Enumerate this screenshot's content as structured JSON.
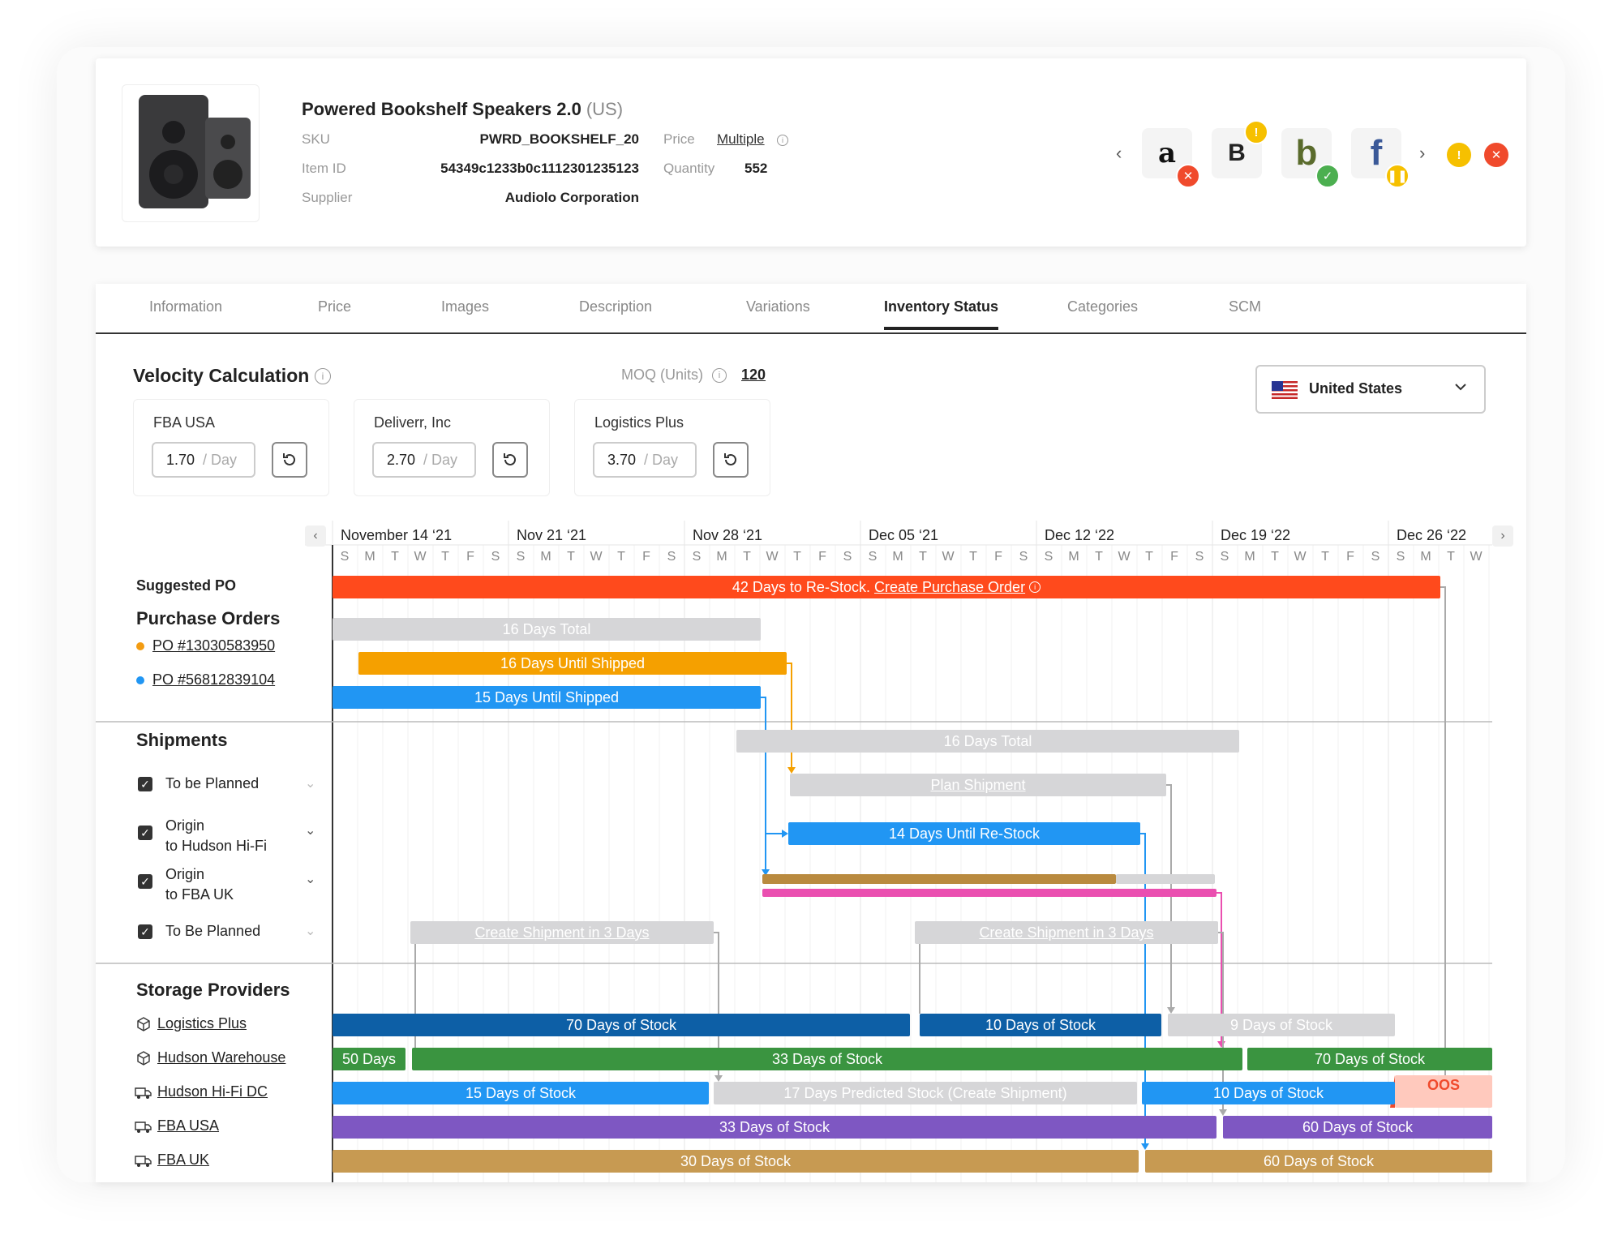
{
  "product": {
    "title": "Powered Bookshelf Speakers 2.0",
    "region": "(US)",
    "sku_label": "SKU",
    "sku": "PWRD_BOOKSHELF_20",
    "item_id_label": "Item ID",
    "item_id": "54349c1233b0c1112301235123",
    "supplier_label": "Supplier",
    "supplier": "Audiolo Corporation",
    "price_label": "Price",
    "price": "Multiple",
    "quantity_label": "Quantity",
    "quantity": "552"
  },
  "marketplaces": [
    {
      "icon": "amazon-icon",
      "glyph": "a",
      "status": "error",
      "status_color": "#f04a2c"
    },
    {
      "icon": "bigcommerce-icon",
      "glyph": "B",
      "status": "warning",
      "status_color": "#f6c000"
    },
    {
      "icon": "bonanza-icon",
      "glyph": "b",
      "status": "ok",
      "status_color": "#4caf50"
    },
    {
      "icon": "facebook-icon",
      "glyph": "f",
      "status": "paused",
      "status_color": "#f6c000"
    }
  ],
  "tabs": [
    "Information",
    "Price",
    "Images",
    "Description",
    "Variations",
    "Inventory Status",
    "Categories",
    "SCM"
  ],
  "active_tab": "Inventory Status",
  "velocity": {
    "title": "Velocity Calculation",
    "moq_label": "MOQ (Units)",
    "moq_value": "120",
    "providers": [
      {
        "name": "FBA USA",
        "value": "1.70",
        "unit": "/ Day"
      },
      {
        "name": "Deliverr, Inc",
        "value": "2.70",
        "unit": "/ Day"
      },
      {
        "name": "Logistics Plus",
        "value": "3.70",
        "unit": "/ Day"
      }
    ],
    "country": "United States"
  },
  "timeline": {
    "weeks": [
      "November 14 ‘21",
      "Nov 21 ‘21",
      "Nov 28 ‘21",
      "Dec 05 ‘21",
      "Dec 12 ‘22",
      "Dec 19 ‘22",
      "Dec 26 ‘22"
    ],
    "day_letters": [
      "S",
      "M",
      "T",
      "W",
      "T",
      "F",
      "S"
    ]
  },
  "groups": {
    "suggested_po": "Suggested PO",
    "purchase_orders": "Purchase Orders",
    "shipments": "Shipments",
    "storage_providers": "Storage Providers"
  },
  "purchase_orders": [
    {
      "label": "PO #13030583950",
      "color": "#f39c12"
    },
    {
      "label": "PO #56812839104",
      "color": "#2196f3"
    }
  ],
  "shipments": [
    {
      "line1": "To be Planned",
      "line2": ""
    },
    {
      "line1": "Origin",
      "line2": "to Hudson Hi-Fi"
    },
    {
      "line1": "Origin",
      "line2": "to FBA UK"
    },
    {
      "line1": "To Be Planned",
      "line2": ""
    }
  ],
  "storage": [
    {
      "label": "Logistics Plus",
      "icon": "box-icon"
    },
    {
      "label": "Hudson Warehouse",
      "icon": "box-icon"
    },
    {
      "label": "Hudson Hi-Fi DC",
      "icon": "truck-icon"
    },
    {
      "label": "FBA USA",
      "icon": "truck-icon"
    },
    {
      "label": "FBA UK",
      "icon": "truck-icon"
    }
  ],
  "bars": {
    "suggested": {
      "text": "42 Days to Re-Stock.",
      "link": "Create Purchase Order"
    },
    "po_total": "16 Days Total",
    "po1": "16 Days Until Shipped",
    "po2": "15 Days Until Shipped",
    "ship_total": "16 Days Total",
    "plan_shipment": "Plan Shipment",
    "restock": "14 Days Until Re-Stock",
    "create_ship_1": "Create Shipment in 3 Days",
    "create_ship_2": "Create Shipment in 3 Days",
    "lp_1": "70 Days of Stock",
    "lp_2": "10 Days of Stock",
    "lp_3": "9 Days of Stock",
    "hw_1": "50 Days",
    "hw_2": "33 Days of Stock",
    "hw_3": "70 Days of Stock",
    "hh_1": "15 Days of Stock",
    "hh_2": "17 Days Predicted Stock (Create Shipment)",
    "hh_3": "10 Days of Stock",
    "oos": "OOS",
    "fu_1": "33 Days of Stock",
    "fu_2": "60 Days of Stock",
    "fk_1": "30 Days of Stock",
    "fk_2": "60 Days of Stock"
  },
  "colors": {
    "suggested": "#ff4a1c",
    "orange": "#f5a000",
    "blue": "#2196f3",
    "navy": "#0d5fa6",
    "green": "#3a9440",
    "purple": "#7e57c2",
    "gold": "#c79a52",
    "pink": "#ea4fb0",
    "oos_bg": "#ffc9bd",
    "oos_text": "#f04a2c"
  }
}
